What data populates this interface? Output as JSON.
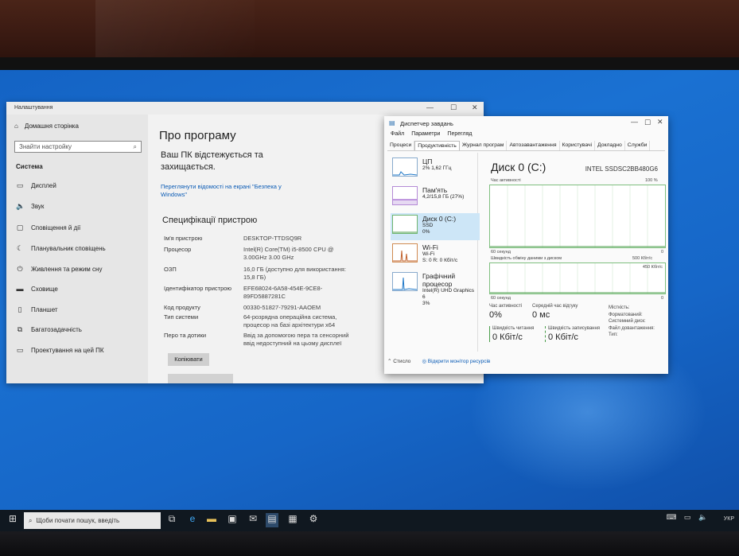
{
  "settings": {
    "title": "Налаштування",
    "home": "Домашня сторінка",
    "search_placeholder": "Знайти настройку",
    "section": "Система",
    "nav": [
      {
        "icon": "display-icon",
        "label": "Дисплей"
      },
      {
        "icon": "sound-icon",
        "label": "Звук"
      },
      {
        "icon": "notifications-icon",
        "label": "Сповіщення й дії"
      },
      {
        "icon": "focus-assist-icon",
        "label": "Планувальник сповіщень"
      },
      {
        "icon": "power-icon",
        "label": "Живлення та режим сну"
      },
      {
        "icon": "storage-icon",
        "label": "Сховище"
      },
      {
        "icon": "tablet-icon",
        "label": "Планшет"
      },
      {
        "icon": "multitasking-icon",
        "label": "Багатозадачність"
      },
      {
        "icon": "projecting-icon",
        "label": "Проектування на цей ПК"
      }
    ],
    "page_title": "Про програму",
    "protect_text": "Ваш ПК відстежується та захищається.",
    "security_link": "Переглянути відомості на екрані \"Безпека у Windows\"",
    "specs_title": "Специфікації пристрою",
    "specs": [
      {
        "k": "Ім'я пристрою",
        "v": "DESKTOP-TTDSQ9R"
      },
      {
        "k": "Процесор",
        "v": "Intel(R) Core(TM) i5-8500 CPU @ 3.00GHz 3.00 GHz"
      },
      {
        "k": "ОЗП",
        "v": "16,0 ГБ (доступно для використання: 15,8 ГБ)"
      },
      {
        "k": "Ідентифікатор пристрою",
        "v": "EFE68024-6A58-454E-9CE8-89FD5887281C"
      },
      {
        "k": "Код продукту",
        "v": "00330-51827-79291-AAOEM"
      },
      {
        "k": "Тип системи",
        "v": "64-розрядна операційна система, процесор на базі архітектури x64"
      },
      {
        "k": "Перо та дотики",
        "v": "Ввід за допомогою пера та сенсорний ввід недоступний на цьому дисплеї"
      }
    ],
    "copy_button": "Копіювати"
  },
  "taskmgr": {
    "title": "Диспетчер завдань",
    "menu": [
      "Файл",
      "Параметри",
      "Перегляд"
    ],
    "tabs": [
      "Процеси",
      "Продуктивність",
      "Журнал програм",
      "Автозавантаження",
      "Користувачі",
      "Докладно",
      "Служби"
    ],
    "active_tab": 1,
    "resources": [
      {
        "name": "ЦП",
        "l1": "2% 1,62 ГГц",
        "l2": ""
      },
      {
        "name": "Пам'ять",
        "l1": "4,2/15,8 ГБ (27%)",
        "l2": ""
      },
      {
        "name": "Диск 0 (C:)",
        "l1": "SSD",
        "l2": "0%"
      },
      {
        "name": "Wi-Fi",
        "l1": "Wi-Fi",
        "l2": "S: 0 R: 0 Кбіт/с"
      },
      {
        "name": "Графічний процесор",
        "l1": "Intel(R) UHD Graphics 6",
        "l2": "3%"
      }
    ],
    "disk_title": "Диск 0 (C:)",
    "disk_model": "INTEL SSDSC2BB480G6",
    "chart1": {
      "label": "Час активності",
      "max": "100 %",
      "left": "60 секунд",
      "right": "0"
    },
    "chart2": {
      "label": "Швидкість обміну даними з диском",
      "max": "500 Кбіт/с",
      "marker": "450 Кбіт/с",
      "left": "60 секунд",
      "right": "0"
    },
    "stats": {
      "active_label": "Час активності",
      "active_value": "0%",
      "response_label": "Середній час відгуку",
      "response_value": "0 мс",
      "read_label": "Швидкість читання",
      "read_value": "0 Кбіт/с",
      "write_label": "Швидкість записування",
      "write_value": "0 Кбіт/с",
      "props": [
        "Місткість:",
        "Форматований:",
        "Системний диск:",
        "Файл довантаження:",
        "Тип:"
      ]
    },
    "footer_less": "Стисло",
    "footer_monitor": "Відкрити монітор ресурсів"
  },
  "taskbar": {
    "search_placeholder": "Щоби почати пошук, введіть",
    "lang": "УКР"
  },
  "chart_data": [
    {
      "type": "line",
      "title": "Час активності",
      "x": [
        0,
        2,
        4,
        6,
        8,
        10,
        12,
        14,
        16,
        18,
        20,
        22,
        24,
        26,
        28,
        30
      ],
      "values": [
        0,
        0,
        0,
        0,
        0,
        0,
        0,
        0,
        0,
        0,
        0,
        0,
        0,
        0,
        0,
        0
      ],
      "ylim": [
        0,
        100
      ]
    },
    {
      "type": "line",
      "title": "Швидкість обміну даними з диском",
      "x": [
        0,
        2,
        4,
        6,
        8,
        10,
        12,
        14,
        16,
        18,
        20,
        22,
        24,
        26,
        28,
        30
      ],
      "values": [
        0,
        0,
        0,
        0,
        0,
        0,
        0,
        0,
        0,
        0,
        0,
        0,
        0,
        0,
        0,
        0
      ],
      "ylim": [
        0,
        500
      ]
    }
  ]
}
